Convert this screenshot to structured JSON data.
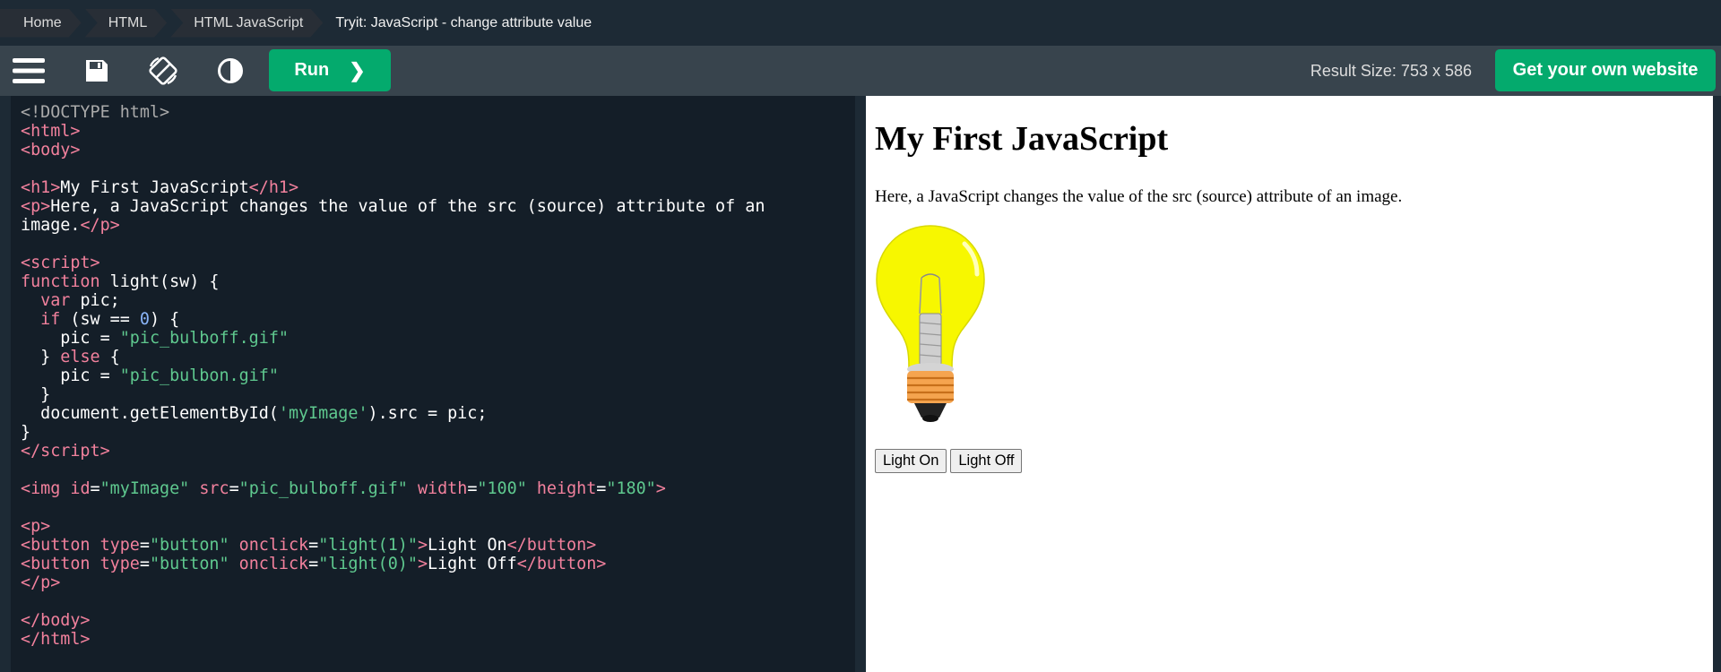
{
  "breadcrumb": {
    "items": [
      "Home",
      "HTML",
      "HTML JavaScript"
    ],
    "current": "Tryit: JavaScript - change attribute value"
  },
  "toolbar": {
    "icons": [
      "menu-icon",
      "save-icon",
      "rotate-icon",
      "contrast-icon"
    ],
    "run_label": "Run",
    "run_chevron": "❯",
    "result_size": "Result Size: 753 x 586",
    "own_website_label": "Get your own website"
  },
  "result": {
    "heading": "My First JavaScript",
    "paragraph": "Here, a JavaScript changes the value of the src (source) attribute of an image.",
    "buttons": [
      "Light On",
      "Light Off"
    ]
  },
  "colors": {
    "accent": "#04aa6d",
    "toolbar_bg": "#38444d",
    "header_bg": "#1d2a35",
    "editor_bg": "#141e28"
  }
}
